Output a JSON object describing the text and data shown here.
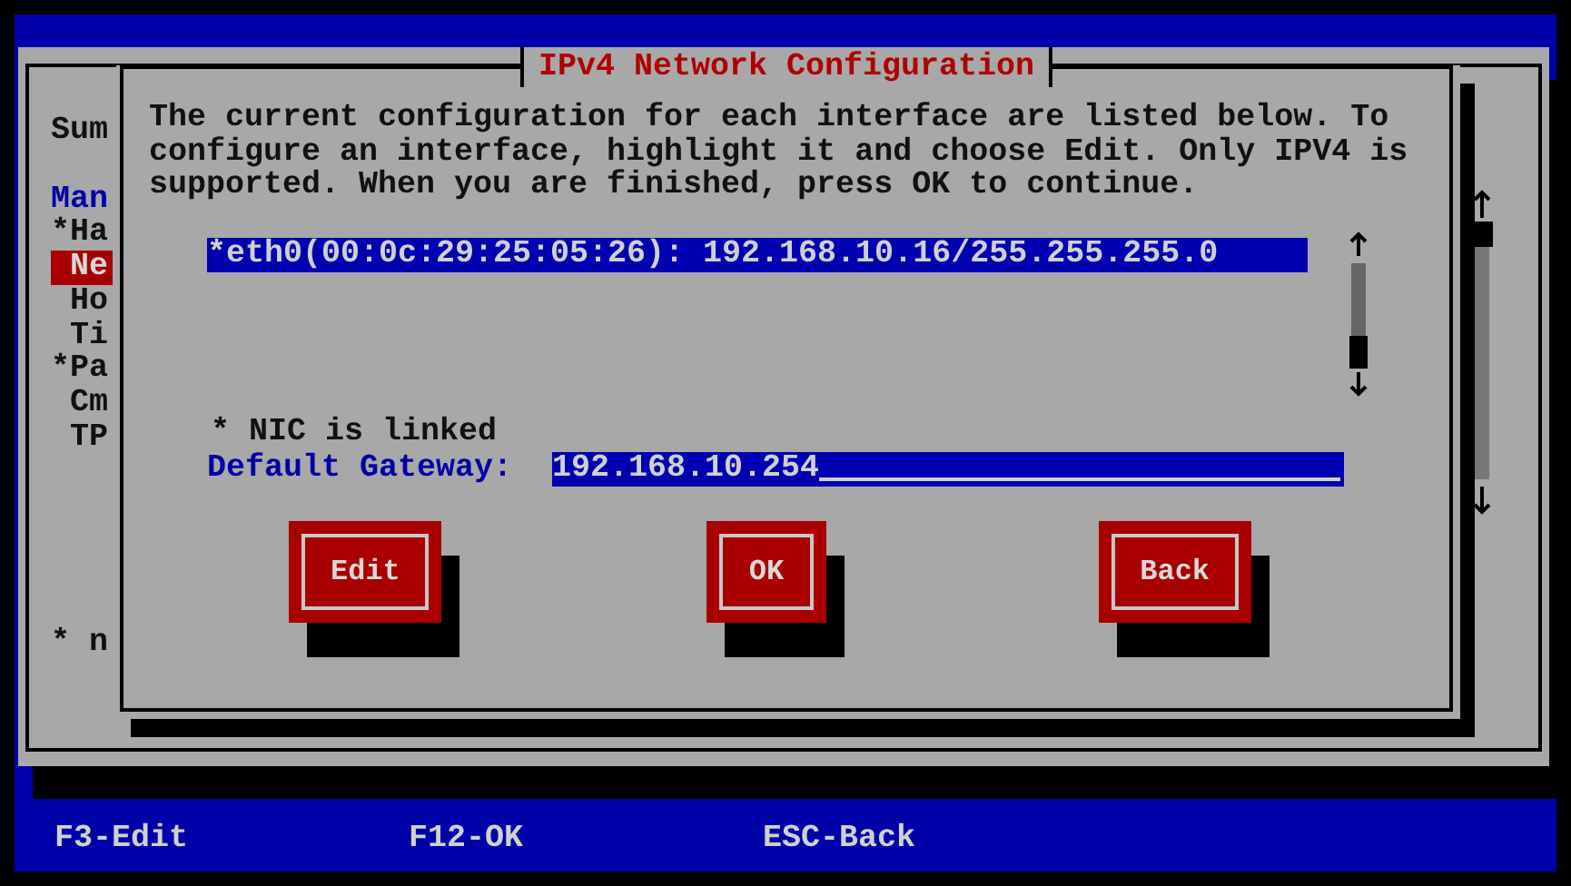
{
  "background": {
    "heading": "Sum",
    "section": "Man",
    "items": [
      {
        "label": "*Ha",
        "selected": false
      },
      {
        "label": " Ne",
        "selected": true
      },
      {
        "label": " Ho",
        "selected": false
      },
      {
        "label": " Ti",
        "selected": false
      },
      {
        "label": "*Pa",
        "selected": false
      },
      {
        "label": " Cm",
        "selected": false
      },
      {
        "label": " TP",
        "selected": false
      }
    ],
    "footnote": "* n"
  },
  "dialog": {
    "title": "IPv4 Network Configuration",
    "message": "The current configuration for each interface are listed below. To configure an interface, highlight it and choose Edit. Only IPV4 is supported. When you are finished, press OK to continue.",
    "interfaces": [
      {
        "label": "*eth0(00:0c:29:25:05:26): 192.168.10.16/255.255.255.0",
        "selected": true
      }
    ],
    "link_status": "* NIC is linked",
    "gateway": {
      "label": "Default Gateway:",
      "value": "192.168.10.254"
    },
    "buttons": [
      {
        "label": "Edit"
      },
      {
        "label": "OK"
      },
      {
        "label": "Back"
      }
    ]
  },
  "status_bar": [
    "F3-Edit",
    "F12-OK",
    "ESC-Back"
  ]
}
